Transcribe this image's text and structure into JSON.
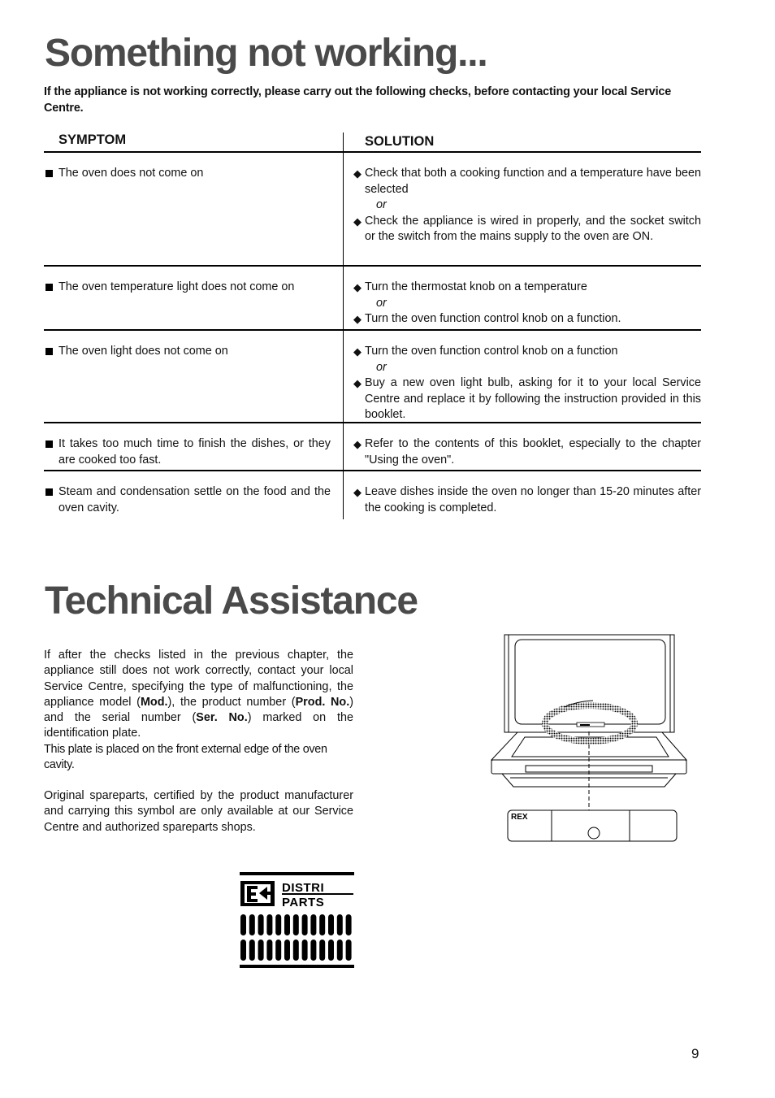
{
  "troubleshooting": {
    "title": "Something not working...",
    "intro": "If the appliance is not working correctly, please carry out the following checks, before contacting your local Service Centre.",
    "columns": {
      "symptom": "SYMPTOM",
      "solution": "SOLUTION"
    },
    "rows": [
      {
        "symptom": "The oven does not come on",
        "solutions": [
          "Check that both a cooking function and a temperature have been selected",
          "Check the appliance is wired in properly, and the socket switch or the switch from the mains supply to the oven are ON."
        ],
        "separator": "or"
      },
      {
        "symptom": "The oven temperature light does not come on",
        "solutions": [
          "Turn the thermostat knob on a temperature",
          "Turn the oven function control knob on a function."
        ],
        "separator": "or"
      },
      {
        "symptom": "The oven light does not come on",
        "solutions": [
          "Turn the oven function control knob on a function",
          "Buy a new oven light bulb, asking for it to your local Service Centre and replace it by following the instruction provided in this booklet."
        ],
        "separator": "or"
      },
      {
        "symptom": "It takes too much time to finish the dishes, or they are cooked too fast.",
        "solutions": [
          "Refer to the contents of this booklet, especially to the chapter \"Using the oven\"."
        ]
      },
      {
        "symptom": "Steam and condensation settle on the food and the oven cavity.",
        "solutions": [
          "Leave dishes inside the oven no longer than 15-20 minutes after the cooking is completed."
        ]
      }
    ],
    "bullet_icon": "square-bullet",
    "solution_icon": "diamond-bullet"
  },
  "assistance": {
    "title": "Technical Assistance",
    "p1_a": "If after the checks listed in the previous chapter, the appliance still does not work correctly, contact your local Service Centre, specifying the type of malfunctioning, the appliance model (",
    "mod": "Mod.",
    "p1_b": "), the product number (",
    "prod": "Prod. No.",
    "p1_c": ") and the serial number (",
    "ser": "Ser. No.",
    "p1_d": ") marked on the identification plate.",
    "p1_e": "This plate is placed on the front external edge of the oven cavity.",
    "p2": "Original spareparts, certified by the product manufacturer and carrying this symbol are only available at our Service Centre and authorized spareparts shops.",
    "plate_label": "REX",
    "logo_line1": "DISTRI",
    "logo_line2": "PARTS"
  },
  "page_number": "9"
}
